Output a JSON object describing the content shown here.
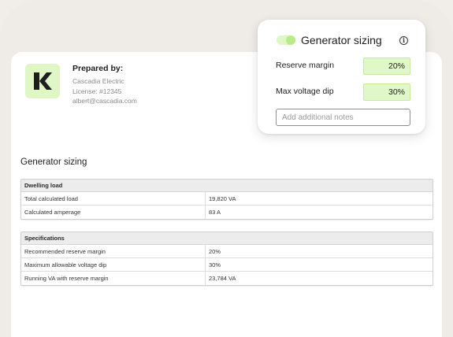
{
  "preparer": {
    "title": "Prepared by:",
    "company": "Cascadia Electric",
    "license": "License: #12345",
    "email": "albert@cascadia.com"
  },
  "report": {
    "section_title": "Generator sizing",
    "tables": [
      {
        "header": "Dwelling load",
        "rows": [
          {
            "label": "Total calculated load",
            "value": "19,820 VA"
          },
          {
            "label": "Calculated amperage",
            "value": "83 A"
          }
        ]
      },
      {
        "header": "Specifications",
        "rows": [
          {
            "label": "Recommended reserve margin",
            "value": "20%"
          },
          {
            "label": "Maximum allowable voltage dip",
            "value": "30%"
          },
          {
            "label": "Running VA with reserve margin",
            "value": "23,784 VA"
          }
        ]
      }
    ]
  },
  "panel": {
    "title": "Generator sizing",
    "toggle_on": true,
    "fields": [
      {
        "label": "Reserve margin",
        "value": "20%"
      },
      {
        "label": "Max voltage dip",
        "value": "30%"
      }
    ],
    "notes_placeholder": "Add additional notes",
    "info_icon": "info-icon"
  },
  "colors": {
    "accent_light": "#dff6c5",
    "accent": "#b9ec86",
    "logo_dark": "#1e1e1e"
  }
}
